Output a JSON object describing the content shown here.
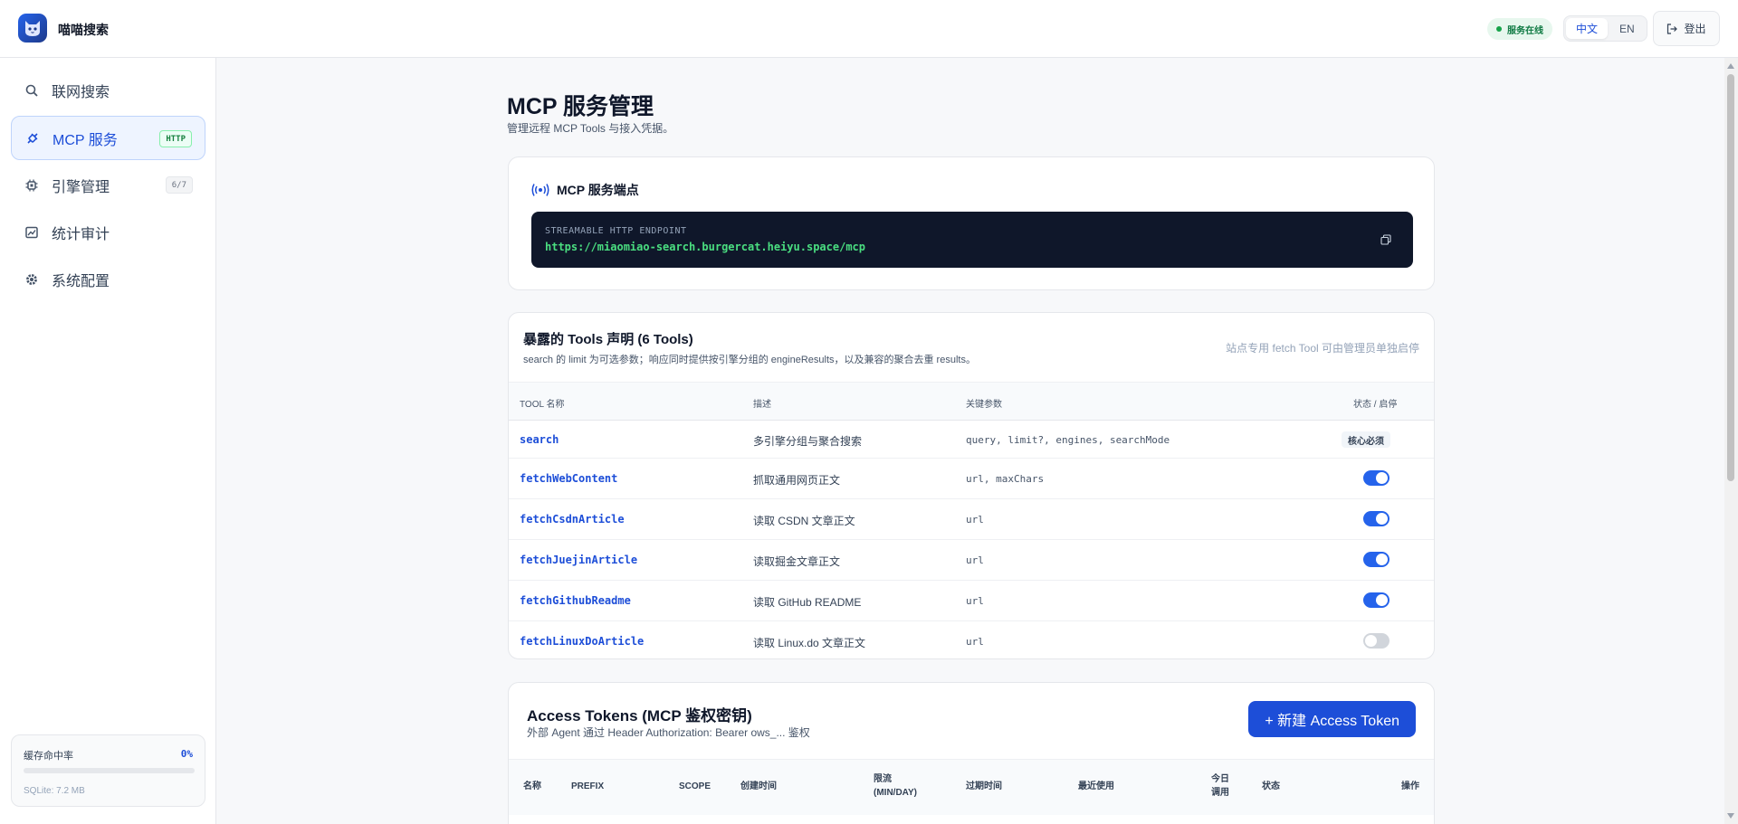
{
  "header": {
    "app_title": "喵喵搜索",
    "status": "服务在线",
    "lang_zh": "中文",
    "lang_en": "EN",
    "logout": "登出"
  },
  "sidebar": {
    "items": [
      {
        "label": "联网搜索",
        "icon": "search-icon"
      },
      {
        "label": "MCP 服务",
        "icon": "plug-icon",
        "badge": "HTTP"
      },
      {
        "label": "引擎管理",
        "icon": "chip-icon",
        "badge": "6/7"
      },
      {
        "label": "统计审计",
        "icon": "chart-icon"
      },
      {
        "label": "系统配置",
        "icon": "gear-icon"
      }
    ],
    "cache": {
      "label": "缓存命中率",
      "value": "0%",
      "fraction": 0.0,
      "db": "SQLite: 7.2 MB"
    }
  },
  "page": {
    "title": "MCP 服务管理",
    "subtitle": "管理远程 MCP Tools 与接入凭据。"
  },
  "endpoint": {
    "title": "MCP 服务端点",
    "label": "STREAMABLE HTTP ENDPOINT",
    "url": "https://miaomiao-search.burgercat.heiyu.space/mcp"
  },
  "tools": {
    "title": "暴露的 Tools 声明 (6 Tools)",
    "desc": "search 的 limit 为可选参数；响应同时提供按引擎分组的 engineResults，以及兼容的聚合去重 results。",
    "note": "站点专用 fetch Tool 可由管理员单独启停",
    "columns": [
      "TOOL 名称",
      "描述",
      "关键参数",
      "状态 / 启停"
    ],
    "rows": [
      {
        "name": "search",
        "desc": "多引擎分组与聚合搜索",
        "params": "query, limit?, engines, searchMode",
        "core": "核心必须",
        "enabled": true
      },
      {
        "name": "fetchWebContent",
        "desc": "抓取通用网页正文",
        "params": "url, maxChars",
        "enabled": true
      },
      {
        "name": "fetchCsdnArticle",
        "desc": "读取 CSDN 文章正文",
        "params": "url",
        "enabled": true
      },
      {
        "name": "fetchJuejinArticle",
        "desc": "读取掘金文章正文",
        "params": "url",
        "enabled": true
      },
      {
        "name": "fetchGithubReadme",
        "desc": "读取 GitHub README",
        "params": "url",
        "enabled": true
      },
      {
        "name": "fetchLinuxDoArticle",
        "desc": "读取 Linux.do 文章正文",
        "params": "url",
        "enabled": false
      }
    ]
  },
  "tokens": {
    "title": "Access Tokens (MCP 鉴权密钥)",
    "desc": "外部 Agent 通过 Header Authorization: Bearer ows_... 鉴权",
    "new_button": "+ 新建 Access Token",
    "columns": {
      "name": "名称",
      "prefix": "PREFIX",
      "scope": "SCOPE",
      "created": "创建时间",
      "rate_1": "限流",
      "rate_2": "(MIN/DAY)",
      "expires": "过期时间",
      "last_used": "最近使用",
      "today_1": "今日",
      "today_2": "调用",
      "status": "状态",
      "actions": "操作"
    }
  },
  "colors": {
    "accent": "#1d4ed8",
    "success": "#16a34a",
    "code_bg": "#0f172a",
    "code_text": "#4ade80"
  }
}
